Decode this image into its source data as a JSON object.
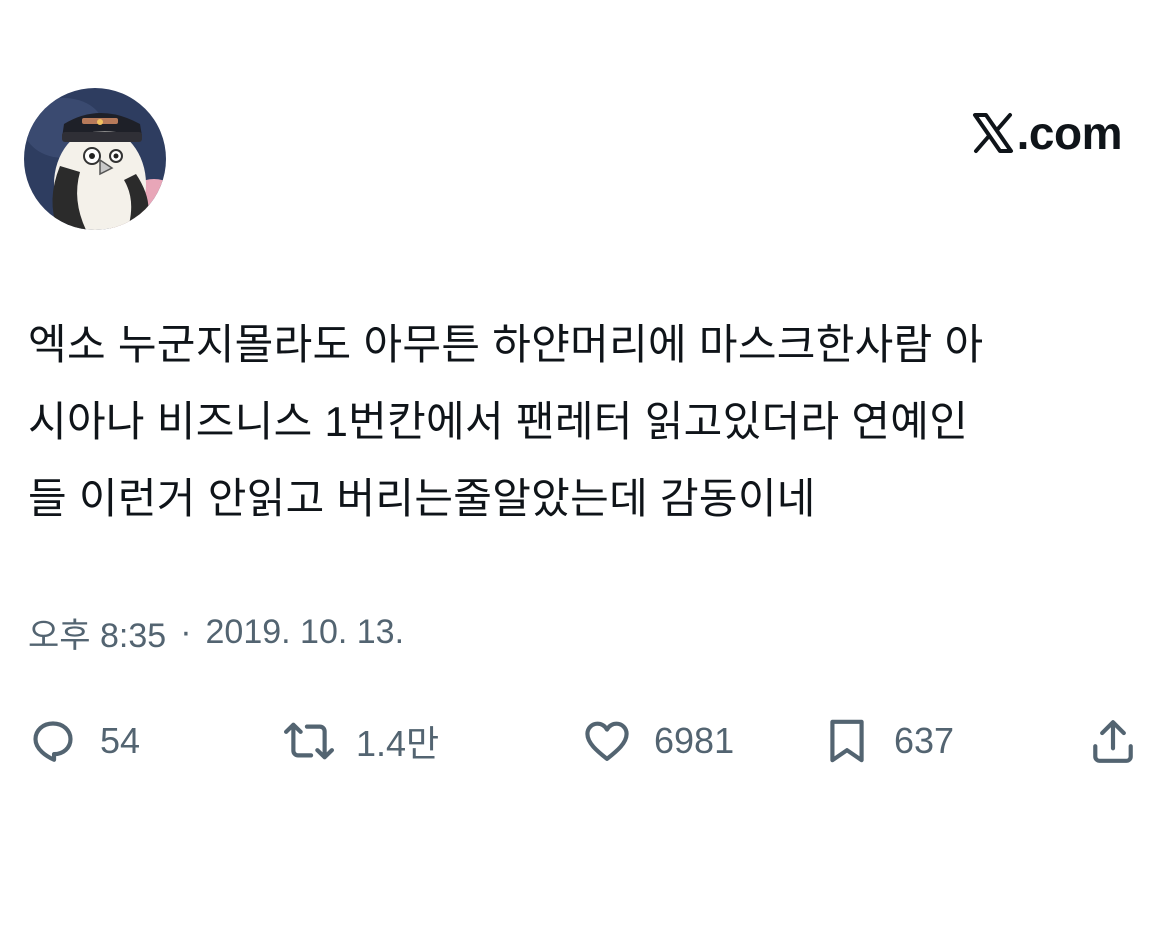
{
  "header": {
    "brand": ".com"
  },
  "tweet": {
    "text_lines": [
      "엑소 누군지몰라도 아무튼 하얀머리에 마스크한사람 아",
      "시아나 비즈니스 1번칸에서 팬레터 읽고있더라 연예인",
      "들 이런거 안읽고 버리는줄알았는데 감동이네"
    ],
    "time": "오후 8:35",
    "separator": "·",
    "date": "2019. 10. 13."
  },
  "actions": {
    "reply": {
      "icon": "reply-icon",
      "count": "54"
    },
    "retweet": {
      "icon": "retweet-icon",
      "count": "1.4만"
    },
    "like": {
      "icon": "heart-icon",
      "count": "6981"
    },
    "bookmark": {
      "icon": "bookmark-icon",
      "count": "637"
    },
    "share": {
      "icon": "share-icon"
    }
  },
  "colors": {
    "text": "#0f1419",
    "secondary": "#536471",
    "avatar_bg": "#2e3d60"
  }
}
